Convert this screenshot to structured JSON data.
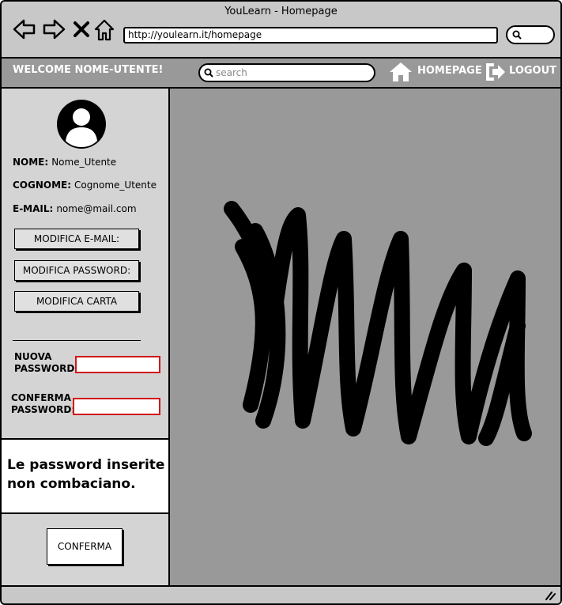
{
  "window": {
    "title": "YouLearn - Homepage"
  },
  "browser": {
    "url": "http://youlearn.it/homepage"
  },
  "header": {
    "welcome": "WELCOME NOME-UTENTE!",
    "search_placeholder": "search",
    "homepage_label": "HOMEPAGE",
    "logout_label": "LOGOUT"
  },
  "profile": {
    "name_label": "NOME:",
    "name_value": "Nome_Utente",
    "surname_label": "COGNOME:",
    "surname_value": "Cognome_Utente",
    "email_label": "E-MAIL:",
    "email_value": "nome@mail.com"
  },
  "actions": {
    "edit_email": "MODIFICA E-MAIL:",
    "edit_password": "MODIFICA PASSWORD:",
    "edit_card": "MODIFICA CARTA"
  },
  "password_form": {
    "new_label_line1": "NUOVA",
    "new_label_line2": "PASSWORD:",
    "confirm_label_line1": "CONFERMA",
    "confirm_label_line2": "PASSWORD:",
    "error": "Le password inserite non combaciano.",
    "submit": "CONFERMA"
  },
  "colors": {
    "error_border": "#d01818",
    "background": "#999999",
    "chrome": "#c8c8c8"
  }
}
